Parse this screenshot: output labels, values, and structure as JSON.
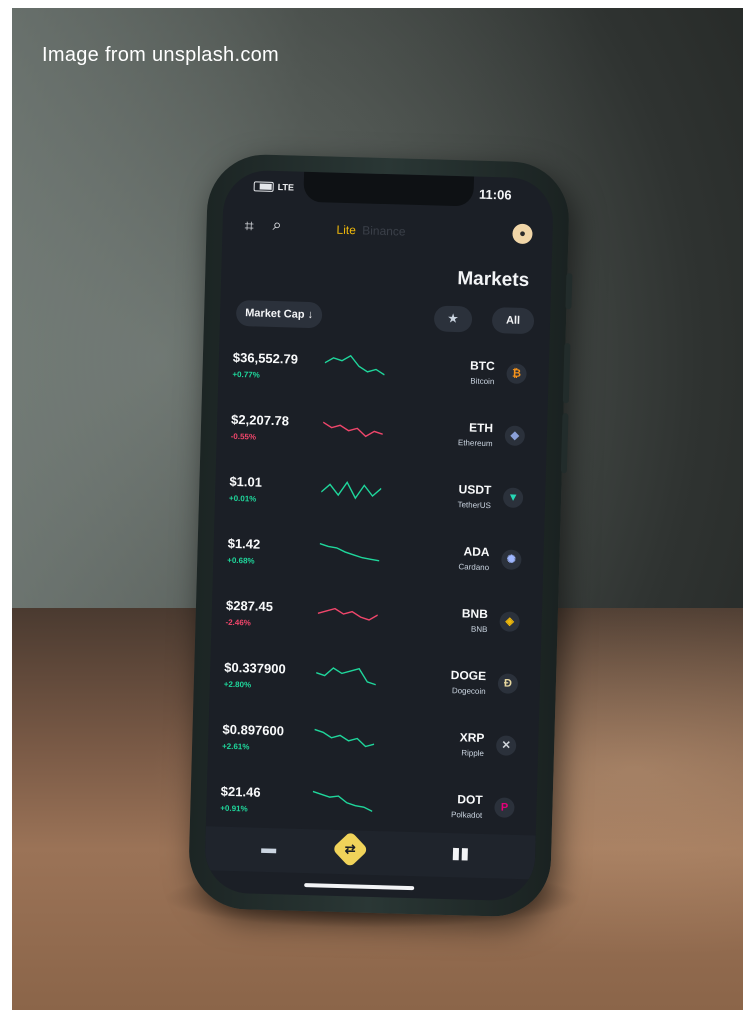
{
  "credit": "Image from unsplash.com",
  "status_bar": {
    "time": "11:06",
    "signal": "LTE"
  },
  "header": {
    "brand_name": "Binance",
    "brand_tag": "Lite",
    "title": "Markets"
  },
  "filters": {
    "sort_label": "Market Cap ↓",
    "favorites_icon": "star-icon",
    "all_label": "All"
  },
  "coins": [
    {
      "symbol": "BTC",
      "name": "Bitcoin",
      "price": "$36,552.79",
      "change": "+0.77%",
      "trend": "up",
      "icon": "bitcoin-icon",
      "color": "#f7931a",
      "spark": [
        0.4,
        0.2,
        0.3,
        0.1,
        0.5,
        0.7,
        0.6,
        0.8
      ]
    },
    {
      "symbol": "ETH",
      "name": "Ethereum",
      "price": "$2,207.78",
      "change": "-0.55%",
      "trend": "down",
      "icon": "ethereum-icon",
      "color": "#8aa0d8",
      "spark": [
        0.3,
        0.5,
        0.4,
        0.6,
        0.5,
        0.8,
        0.6,
        0.7
      ]
    },
    {
      "symbol": "USDT",
      "name": "TetherUS",
      "price": "$1.01",
      "change": "+0.01%",
      "trend": "up",
      "icon": "tether-icon",
      "color": "#26d6b5",
      "spark": [
        0.6,
        0.3,
        0.7,
        0.2,
        0.8,
        0.3,
        0.7,
        0.4
      ]
    },
    {
      "symbol": "ADA",
      "name": "Cardano",
      "price": "$1.42",
      "change": "+0.68%",
      "trend": "up",
      "icon": "cardano-icon",
      "color": "#9fb7ff",
      "spark": [
        0.2,
        0.3,
        0.35,
        0.5,
        0.6,
        0.7,
        0.75,
        0.8
      ]
    },
    {
      "symbol": "BNB",
      "name": "BNB",
      "price": "$287.45",
      "change": "-2.46%",
      "trend": "down",
      "icon": "bnb-icon",
      "color": "#f0b90b",
      "spark": [
        0.5,
        0.4,
        0.3,
        0.5,
        0.4,
        0.6,
        0.7,
        0.5
      ]
    },
    {
      "symbol": "DOGE",
      "name": "Dogecoin",
      "price": "$0.337900",
      "change": "+2.80%",
      "trend": "up",
      "icon": "dogecoin-icon",
      "color": "#e8d8a0",
      "spark": [
        0.4,
        0.5,
        0.2,
        0.4,
        0.3,
        0.2,
        0.7,
        0.8
      ]
    },
    {
      "symbol": "XRP",
      "name": "Ripple",
      "price": "$0.897600",
      "change": "+2.61%",
      "trend": "up",
      "icon": "ripple-icon",
      "color": "#d1d5db",
      "spark": [
        0.2,
        0.3,
        0.5,
        0.4,
        0.6,
        0.5,
        0.8,
        0.7
      ]
    },
    {
      "symbol": "DOT",
      "name": "Polkadot",
      "price": "$21.46",
      "change": "+0.91%",
      "trend": "up",
      "icon": "polkadot-icon",
      "color": "#e6007a",
      "spark": [
        0.2,
        0.3,
        0.4,
        0.35,
        0.6,
        0.7,
        0.75,
        0.9
      ]
    }
  ],
  "nav": {
    "wallet_icon": "wallet-icon",
    "convert_icon": "convert-icon",
    "chart_icon": "bar-chart-icon"
  }
}
